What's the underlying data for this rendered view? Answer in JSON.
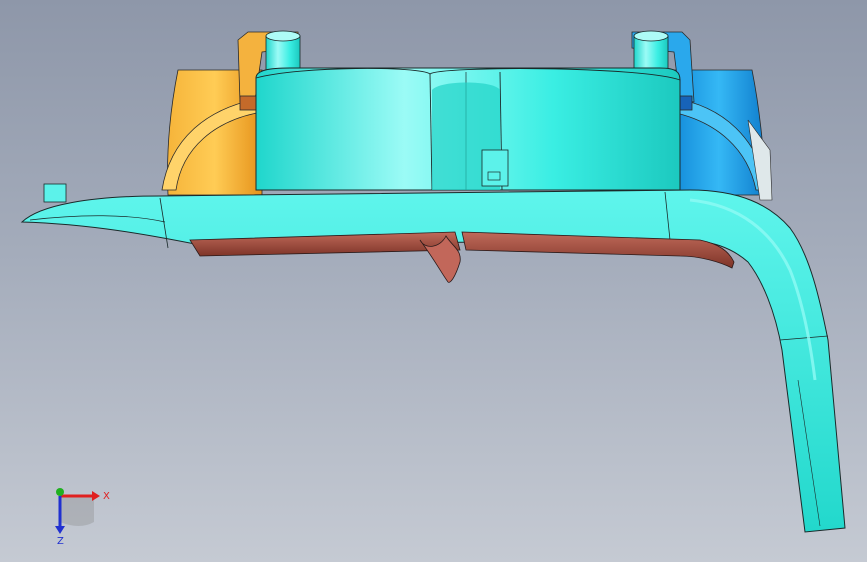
{
  "viewport": {
    "background_top": "#8e97a9",
    "background_bottom": "#c5cad3"
  },
  "model": {
    "colors": {
      "cyan_body": "#2ee8dc",
      "cyan_highlight": "#8ffaf4",
      "orange_part": "#f2a51f",
      "blue_part": "#1a9be8",
      "brown_edge": "#9c4a3c",
      "edge_line": "#1a2a2a"
    }
  },
  "triad": {
    "x_label": "X",
    "z_label": "Z",
    "x_color": "#e02020",
    "y_color": "#20b020",
    "z_color": "#2030d0"
  }
}
